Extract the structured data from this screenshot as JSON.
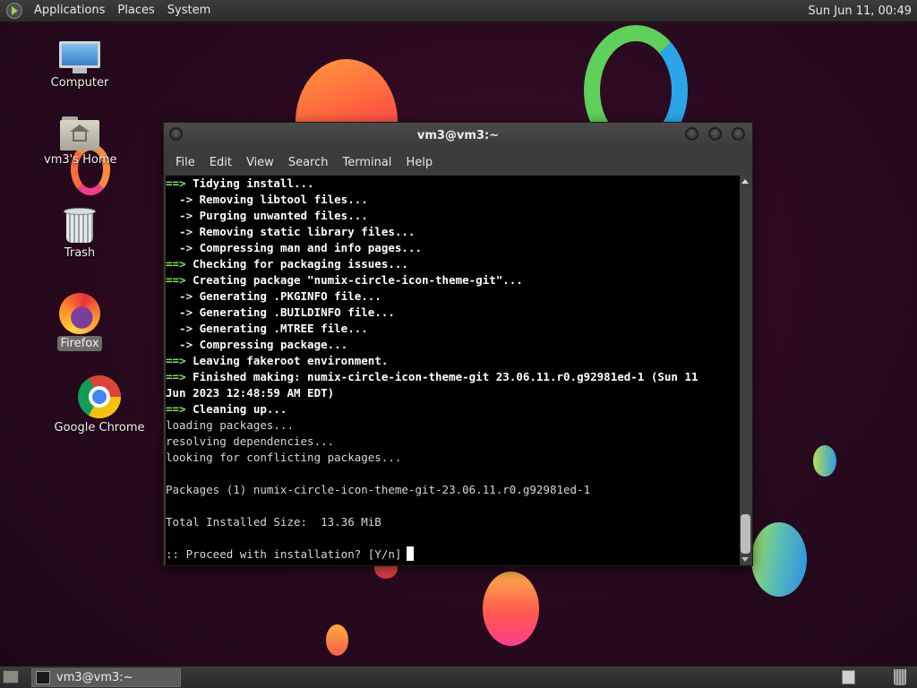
{
  "top_panel": {
    "menus": [
      "Applications",
      "Places",
      "System"
    ],
    "clock": "Sun Jun 11, 00:49"
  },
  "desktop": {
    "icons": [
      {
        "label": "Computer",
        "icon": "computer-icon"
      },
      {
        "label": "vm3's Home",
        "icon": "home-folder-icon"
      },
      {
        "label": "Trash",
        "icon": "trash-icon"
      },
      {
        "label": "Firefox",
        "icon": "firefox-icon",
        "selected": true
      },
      {
        "label": "Google Chrome",
        "icon": "chrome-icon"
      }
    ]
  },
  "terminal": {
    "title": "vm3@vm3:~",
    "menus": [
      "File",
      "Edit",
      "View",
      "Search",
      "Terminal",
      "Help"
    ],
    "lines": [
      {
        "prefix": "==>",
        "text": " Tidying install..."
      },
      {
        "prefix": "  ->",
        "text": " Removing libtool files..."
      },
      {
        "prefix": "  ->",
        "text": " Purging unwanted files..."
      },
      {
        "prefix": "  ->",
        "text": " Removing static library files..."
      },
      {
        "prefix": "  ->",
        "text": " Compressing man and info pages..."
      },
      {
        "prefix": "==>",
        "text": " Checking for packaging issues..."
      },
      {
        "prefix": "==>",
        "text": " Creating package \"numix-circle-icon-theme-git\"..."
      },
      {
        "prefix": "  ->",
        "text": " Generating .PKGINFO file..."
      },
      {
        "prefix": "  ->",
        "text": " Generating .BUILDINFO file..."
      },
      {
        "prefix": "  ->",
        "text": " Generating .MTREE file..."
      },
      {
        "prefix": "  ->",
        "text": " Compressing package..."
      },
      {
        "prefix": "==>",
        "text": " Leaving fakeroot environment."
      },
      {
        "prefix": "==>",
        "text": " Finished making: numix-circle-icon-theme-git 23.06.11.r0.g92981ed-1 (Sun 11"
      },
      {
        "prefix": "",
        "text": "Jun 2023 12:48:59 AM EDT)",
        "bold": true
      },
      {
        "prefix": "==>",
        "text": " Cleaning up..."
      },
      {
        "prefix": "",
        "text": "loading packages..."
      },
      {
        "prefix": "",
        "text": "resolving dependencies..."
      },
      {
        "prefix": "",
        "text": "looking for conflicting packages..."
      },
      {
        "prefix": "",
        "text": ""
      },
      {
        "prefix": "",
        "text": "Packages (1) numix-circle-icon-theme-git-23.06.11.r0.g92981ed-1"
      },
      {
        "prefix": "",
        "text": ""
      },
      {
        "prefix": "",
        "text": "Total Installed Size:  13.36 MiB"
      },
      {
        "prefix": "",
        "text": ""
      },
      {
        "prefix": "",
        "text": ":: Proceed with installation? [Y/n]"
      }
    ]
  },
  "bottom_panel": {
    "task": "vm3@vm3:~"
  }
}
